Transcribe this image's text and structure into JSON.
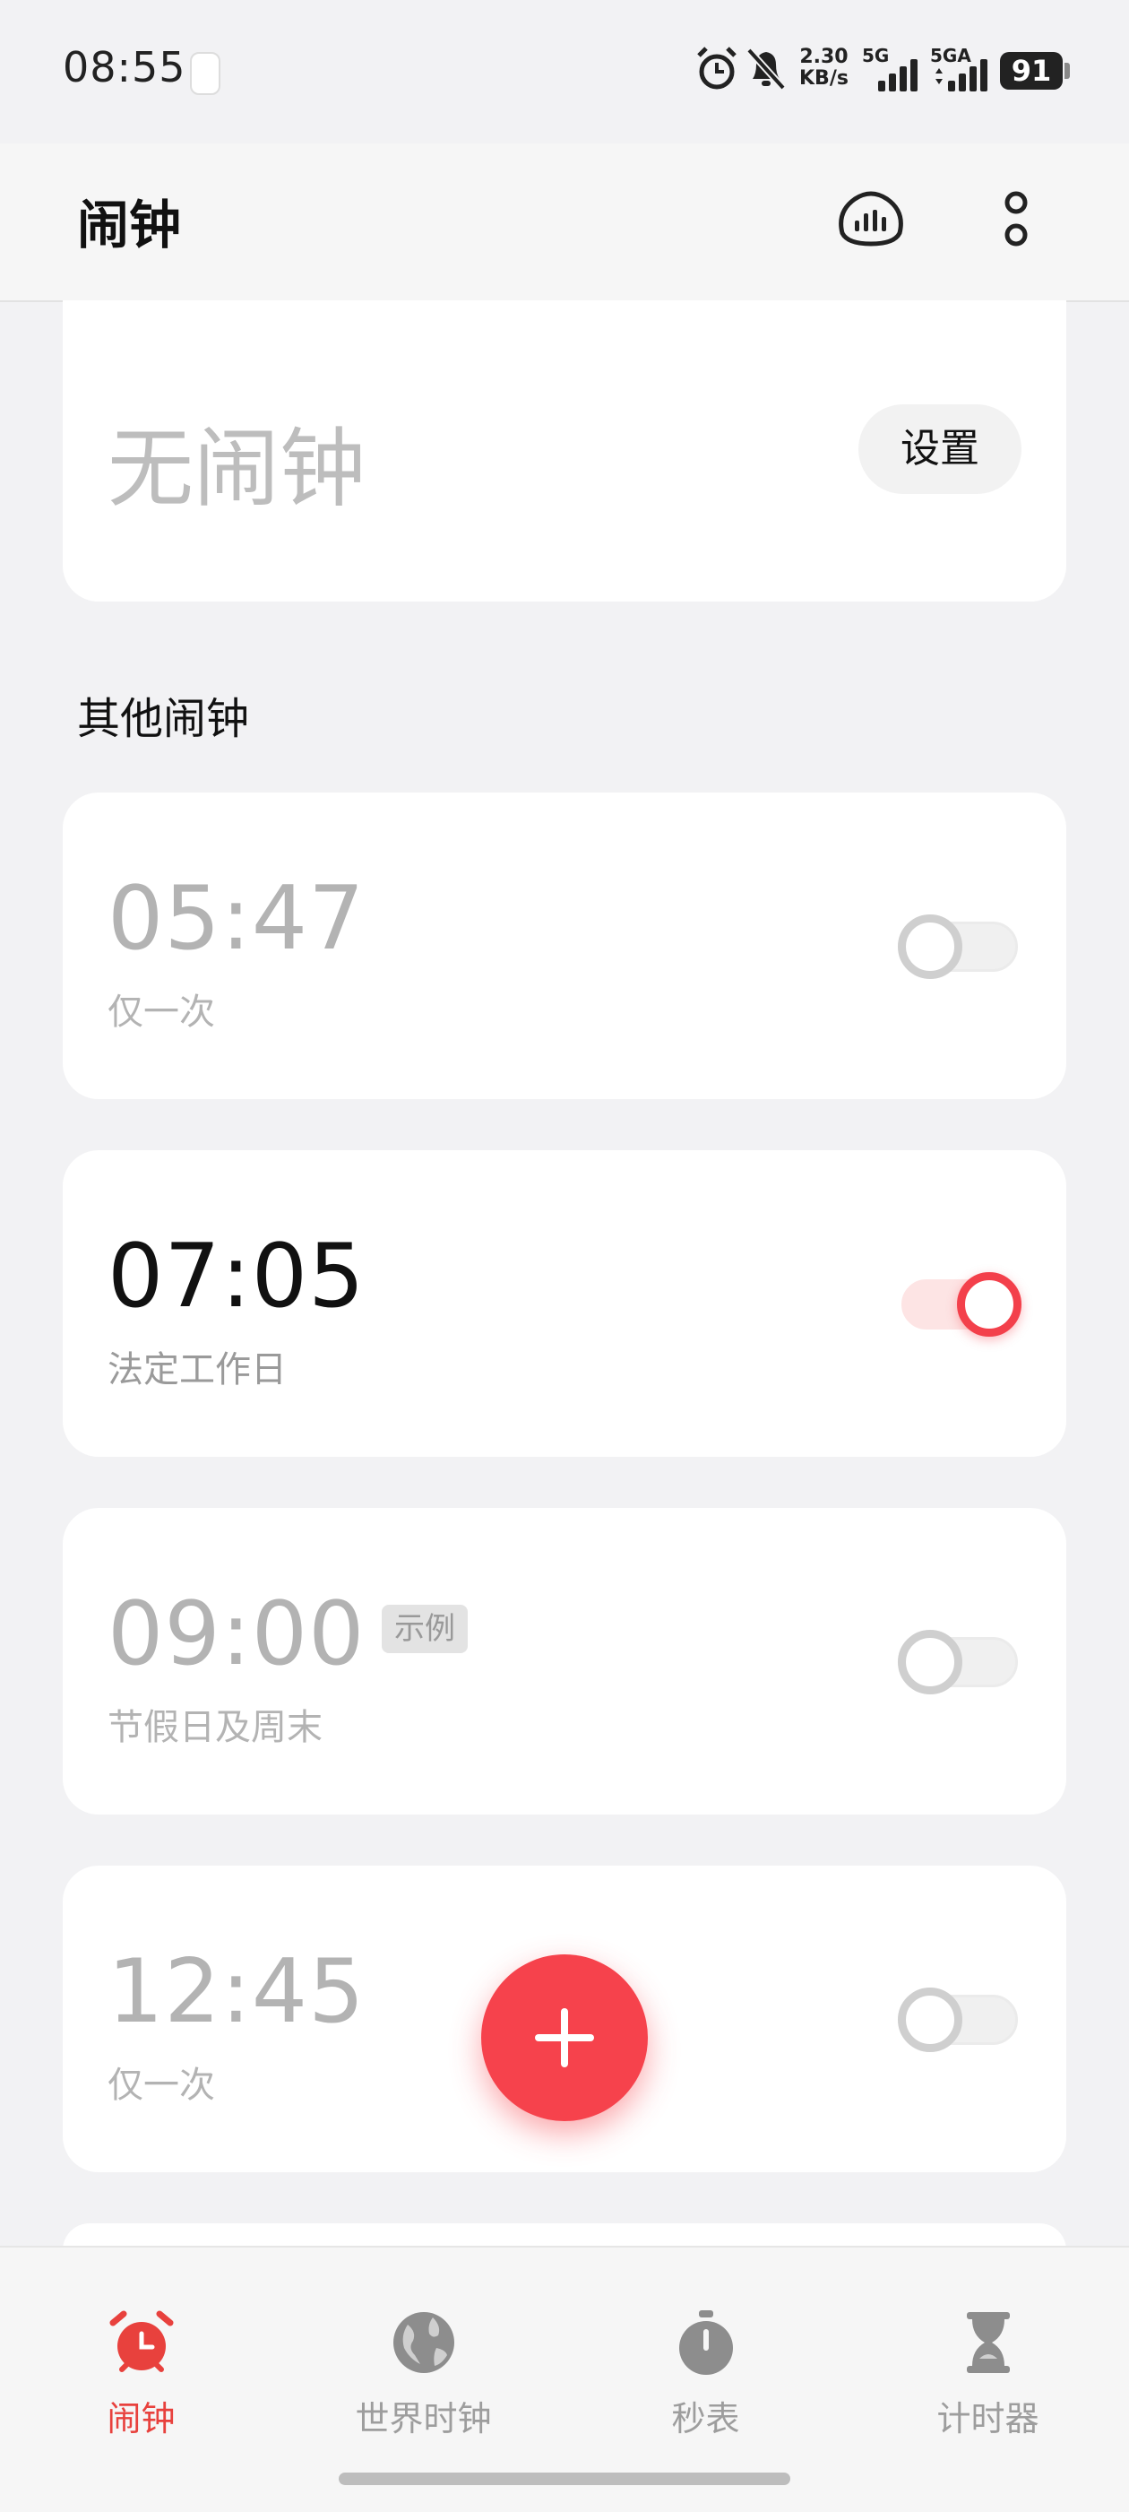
{
  "status_bar": {
    "time": "08:55",
    "net_speed_value": "2.30",
    "net_speed_unit": "KB/s",
    "signal1_label": "5G",
    "signal2_label": "5GA",
    "battery": "91"
  },
  "header": {
    "title": "闹钟"
  },
  "next_alarm_card": {
    "title": "无闹钟",
    "set_button": "设置"
  },
  "section": {
    "title": "其他闹钟"
  },
  "alarms": [
    {
      "time": "05:47",
      "repeat": "仅一次",
      "enabled": false,
      "tag": ""
    },
    {
      "time": "07:05",
      "repeat": "法定工作日",
      "enabled": true,
      "tag": ""
    },
    {
      "time": "09:00",
      "repeat": "节假日及周末",
      "enabled": false,
      "tag": "示例"
    },
    {
      "time": "12:45",
      "repeat": "仅一次",
      "enabled": false,
      "tag": ""
    }
  ],
  "colors": {
    "accent": "#f6424c",
    "active_nav": "#e8413d",
    "inactive": "#9d9d9d"
  },
  "bottom_nav": {
    "items": [
      {
        "label": "闹钟",
        "icon": "alarm-clock-icon",
        "active": true
      },
      {
        "label": "世界时钟",
        "icon": "globe-icon",
        "active": false
      },
      {
        "label": "秒表",
        "icon": "stopwatch-icon",
        "active": false
      },
      {
        "label": "计时器",
        "icon": "hourglass-icon",
        "active": false
      }
    ]
  }
}
